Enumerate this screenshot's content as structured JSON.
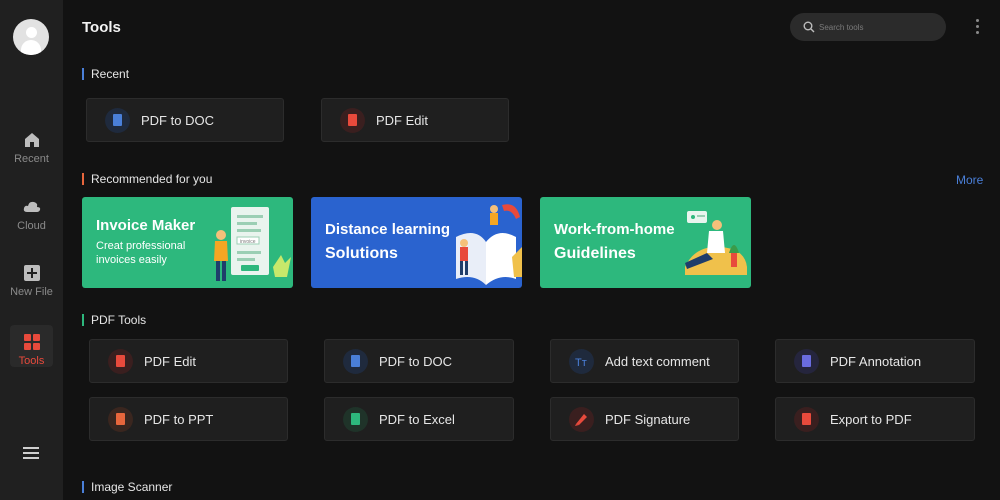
{
  "header": {
    "title": "Tools",
    "search_placeholder": "Search tools"
  },
  "sidebar": {
    "items": [
      {
        "label": "Recent",
        "icon": "home-icon"
      },
      {
        "label": "Cloud",
        "icon": "cloud-icon"
      },
      {
        "label": "New File",
        "icon": "new-file-icon"
      },
      {
        "label": "Tools",
        "icon": "tools-grid-icon",
        "active": true
      }
    ]
  },
  "sections": {
    "recent": {
      "title": "Recent",
      "items": [
        {
          "label": "PDF to DOC",
          "icon": "doc-icon",
          "color": "#4a7fd8"
        },
        {
          "label": "PDF Edit",
          "icon": "pdf-edit-icon",
          "color": "#e84a3c"
        }
      ]
    },
    "recommended": {
      "title": "Recommended for you",
      "more": "More",
      "banners": [
        {
          "title": "Invoice Maker",
          "subtitle_line1": "Creat professional",
          "subtitle_line2": "invoices easily",
          "badge": "invoice",
          "color": "#2db87d"
        },
        {
          "title": "Distance learning",
          "subtitle": "Solutions",
          "color": "#2a63cf"
        },
        {
          "title": "Work-from-home",
          "subtitle": "Guidelines",
          "color": "#2db87d"
        }
      ]
    },
    "pdf_tools": {
      "title": "PDF Tools",
      "items": [
        {
          "label": "PDF Edit",
          "icon": "pdf-edit-icon",
          "color": "#e84a3c"
        },
        {
          "label": "PDF to DOC",
          "icon": "doc-icon",
          "color": "#4a7fd8"
        },
        {
          "label": "Add text comment",
          "icon": "text-comment-icon",
          "color": "#4a7fd8"
        },
        {
          "label": "PDF Annotation",
          "icon": "annotation-icon",
          "color": "#6a6ce0"
        },
        {
          "label": "PDF to PPT",
          "icon": "ppt-icon",
          "color": "#e8663c"
        },
        {
          "label": "PDF to Excel",
          "icon": "excel-icon",
          "color": "#2db87d"
        },
        {
          "label": "PDF Signature",
          "icon": "signature-icon",
          "color": "#e84a3c"
        },
        {
          "label": "Export to PDF",
          "icon": "export-pdf-icon",
          "color": "#e84a3c"
        }
      ]
    },
    "image_scanner": {
      "title": "Image Scanner"
    }
  },
  "colors": {
    "accent_red": "#e84a3c",
    "accent_blue": "#4a7fd8",
    "accent_green": "#2db87d",
    "background": "#121212",
    "sidebar": "#202020"
  }
}
